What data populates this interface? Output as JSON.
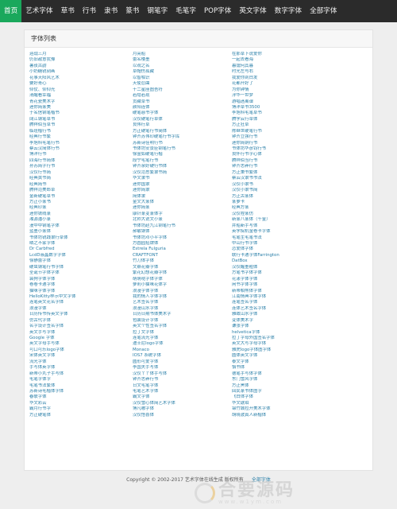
{
  "nav": {
    "items": [
      "首页",
      "艺术字体",
      "草书",
      "行书",
      "隶书",
      "篆书",
      "钢笔字",
      "毛笔字",
      "POP字体",
      "英文字体",
      "数字字体",
      "全部字体"
    ],
    "active_index": 0
  },
  "panel": {
    "title": "字体列表",
    "columns": [
      [
        "迎战三月",
        "仍旧敌意犹豫",
        "暑夜古韵",
        "小奶糖锐刻画",
        "花事天阳风艺术",
        "要好青心",
        "仰仗、仰仰光",
        "清醒看幸福",
        "青花瓷美术字",
        "迷你简篆美",
        "于名信钢笔楷书",
        "阔江钢笔草书",
        "腾祥伯当草书",
        "临班楷行书",
        "经典行书繁",
        "李旭科毛笔行书",
        "蔡云汉简体行书",
        "博洋行书",
        "四海行书简体",
        "孙苏简字行书",
        "汉仪行书简",
        "经典黄书简",
        "经典简书",
        "腾祥范美郎草",
        "金新硬笔草书",
        "方正小篆书",
        "经典印篆",
        "迷你铁线篆",
        "湘源潘小篆",
        "漫中中钢笔字体",
        "蓝墨小篆体",
        "书体坊锐践隶行草体",
        "晒之不家字体",
        "Dr Carbfred",
        "LcdD液晶数字字体",
        "徐静蕾字体",
        "硬虫钢笔行书字体",
        "圣诞节字体字体",
        "袋狗字体字体",
        "卷卷卡通字体",
        "猫咪字体字体",
        "HelloKitty样示中文字体",
        "连笔英文花名字体",
        "浪漫字体",
        "日历传书传英文字体",
        "仿古代字体",
        "名字设计签名字体",
        "英文手写字体",
        "Google 字体",
        "英文字母手写体",
        "可口可乐logo字体",
        "宋体英文字体",
        "流光字体",
        "手写体英字体",
        "新蒂小丸子手写体",
        "毛笔字体字",
        "毛笔书法繁体",
        "苏新诗毛楷体字体",
        "春联字体",
        "华文彩云",
        "霸月行书字",
        "方正硬笔体"
      ],
      [
        "月亮船",
        "蕾名楼墨",
        "以观之名",
        "草帽伤孤藏",
        "以智相识",
        "天使恋曲",
        "十二星座图吾符",
        "若隐若现",
        "贡藏草书",
        "颜阳连体",
        "硬笔慈书字体",
        "汉仪硬笔行草体",
        "良伟行草",
        "方正硬笔行书简体",
        "钟齐苏伟印硬笔行书字库",
        "苏新诗佳明行书",
        "书体坊安景臣钢笔行书",
        "徐金如硬笔行楷",
        "段宁毛笔行书",
        "钟齐余好硬行书体",
        "汉仪范思繁隶书简",
        "华文隶书",
        "迷你国隶",
        "迷你简隶",
        "简体隶",
        "金文大篆体",
        "迷你简篆",
        "康针篆变篆体字",
        "北师大说文小篆",
        "书体坊赵九江钢笔行书",
        "郝敏钢体",
        "书体坊邓小平字体",
        "方圆园招牌体",
        "Estrela Fulguria",
        "CRAFTFONT",
        "竹刀体字体",
        "文鼎花瓣字体",
        "繁花幻想花瓣字体",
        "萌萌哒字体字体",
        "萝莉小猫咪花体字",
        "浪漫字体字体",
        "我的情人字体字体",
        "艺术签名字体",
        "浪漫山水字体",
        "日历日期书体美术字",
        "包装设计字体",
        "英文个性签名字体",
        "拉丁文字体",
        "连笔流光字体",
        "迪士尼logo字体",
        "Monaco",
        "IOS7 系统字体",
        "圆形可爱字体",
        "李国夫手写体",
        "汉仪丫丫体手写体",
        "钟齐志莽行书",
        "日文毛笔字体",
        "毛笔艺术字体",
        "霸文字体",
        "汉仪雪心体简艺术字体",
        "博凡嗷字体",
        "汉仪悟喜体"
      ],
      [
        "在那草下说爱你",
        "一起去看海",
        "暮霭何其暮",
        "时光左与右",
        "我爱你到白发",
        "花都开好了",
        "为你钟情",
        "浮华一世梦",
        "游唱迷离谱",
        "博洋草书3500",
        "李旭科毛笔草书",
        "腾学云行草体",
        "方正狂草",
        "陈继世硬笔行书",
        "钟齐立强行书",
        "迷你简铜行书",
        "书体坊华彦钧行书",
        "良怀行书字心体",
        "腾祥伯当行书",
        "钟齐志莽行书",
        "方正秉书繁体",
        "蔡云汉隶书书法",
        "汉仪小隶书",
        "汉仪小隶书简",
        "方正古篆体",
        "篆萝卡",
        "经典方篆",
        "汉仪程篆仿",
        "新篆八篆体（千金）",
        "并船新手写体",
        "英学院机金卷卡字体",
        "毛笔生毛笔书法",
        "中山行书字体",
        "恋爱体字体",
        "联行卡通字体Farrington",
        "DatBox",
        "汉仪醒墨粗体",
        "方笔书字体字体",
        "花漾字体字体",
        "闲书字体字体",
        "新蒂帕熊体字体",
        "江南情典字体字体",
        "连笔签名字体",
        "连体艺术签名字体",
        "雅致山水字体",
        "变体美术字",
        "谦张字体",
        "helvetica字体",
        "拉丁字母外国签名字体",
        "英文大写字母字体",
        "雅虎logo字体图字体",
        "圆体英文字体",
        "泰文字体",
        "慎书体",
        "德笔手写体字体",
        "东门雪风字体",
        "方正黑体",
        "回民篆书体图字",
        "飞白体字体",
        "华文琥珀",
        "锦竹城拉开美术字体",
        "胡晓波真人新楷体"
      ]
    ]
  },
  "footer": {
    "copyright": "Copyright © 2002-2017 艺术字体在线生成 版权所有",
    "link": "全部字体"
  },
  "watermark": {
    "title": "合要源码",
    "url": "www.w1ym.com"
  },
  "colors": {
    "nav_bg": "#2b2b2b",
    "nav_active": "#1aa85c",
    "link": "#2a7fa8",
    "page_bg": "#eeeeee"
  }
}
